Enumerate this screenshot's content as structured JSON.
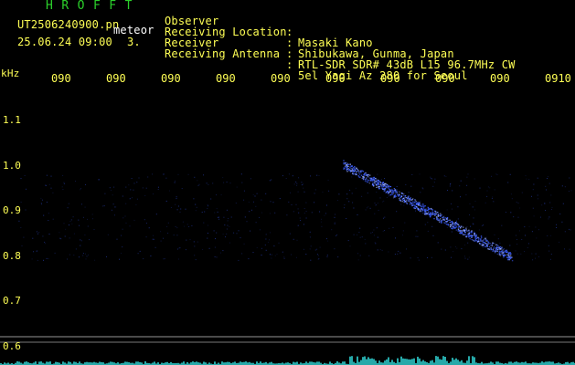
{
  "header": {
    "program_name": "HROFFT",
    "filename": "UT2506240900.pn",
    "detection_label": "meteor",
    "datetime": "25.06.24 09:00",
    "count": "3."
  },
  "metadata": [
    {
      "label": "Observer",
      "value": "Masaki Kano"
    },
    {
      "label": "Receiving Location",
      "value": "Shibukawa, Gunma, Japan"
    },
    {
      "label": "Receiver",
      "value": "RTL-SDR SDR# 43dB L15 96.7MHz CW"
    },
    {
      "label": "Receiving Antenna",
      "value": "5el Yagi Az 280 for Seoul"
    }
  ],
  "axes": {
    "frequency_unit": "kHz",
    "frequency_ticks": [
      {
        "label": "1.1",
        "value": 1.1
      },
      {
        "label": "1.0",
        "value": 1.0
      },
      {
        "label": "0.9",
        "value": 0.9
      },
      {
        "label": "0.8",
        "value": 0.8
      },
      {
        "label": "0.7",
        "value": 0.7
      },
      {
        "label": "0.6",
        "value": 0.6
      }
    ],
    "time_ticks": [
      "090",
      "090",
      "090",
      "090",
      "090",
      "090",
      "090",
      "090",
      "090",
      "0910"
    ]
  },
  "colors": {
    "text_primary": "#ffff55",
    "text_title": "#2bd12b",
    "background": "#000000",
    "signal": "#3a5cff",
    "signal_bright": "#9fb3ff",
    "baseline": "#2fd3d3"
  }
}
